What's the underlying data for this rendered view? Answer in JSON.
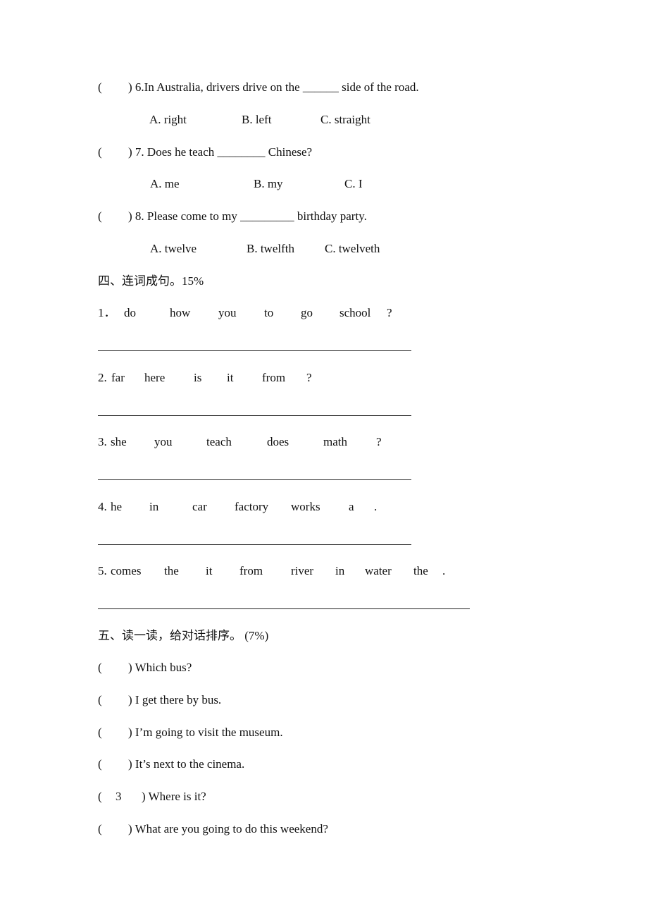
{
  "mc": [
    {
      "num": "6.",
      "stem": "In Australia, drivers drive on the ______ side of the road.",
      "answer": "",
      "options": [
        "A. right",
        "B. left",
        "C. straight"
      ]
    },
    {
      "num": "7.",
      "stem": "Does he teach ________ Chinese?",
      "answer": "",
      "options": [
        "A. me",
        "B. my",
        "C. I"
      ]
    },
    {
      "num": "8.",
      "stem": "Please come to my _________ birthday party.",
      "answer": "",
      "options": [
        "A. twelve",
        "B. twelfth",
        "C. twelveth"
      ]
    }
  ],
  "section4": {
    "title": "四、连词成句。15%",
    "items": [
      {
        "num": "1．",
        "words": [
          "do",
          "how",
          "you",
          "to",
          "go",
          "school",
          "?"
        ]
      },
      {
        "num": "2.",
        "words": [
          "far",
          "here",
          "is",
          "it",
          "from",
          "?"
        ]
      },
      {
        "num": "3.",
        "words": [
          "she",
          "you",
          "teach",
          "does",
          "math",
          "?"
        ]
      },
      {
        "num": "4.",
        "words": [
          "he",
          "in",
          "car",
          "factory",
          "works",
          "a",
          "."
        ]
      },
      {
        "num": "5.",
        "words": [
          "comes",
          "the",
          "it",
          "from",
          "river",
          "in",
          "water",
          "the",
          "."
        ]
      }
    ]
  },
  "section5": {
    "title": "五、读一读，给对话排序。 (7%)",
    "items": [
      {
        "answer": "",
        "text": ") Which bus?"
      },
      {
        "answer": "",
        "text": ") I get there by bus."
      },
      {
        "answer": "",
        "text": ") I’m going to visit the museum."
      },
      {
        "answer": "",
        "text": ") It’s next to the cinema."
      },
      {
        "answer": "3",
        "text": ") Where is it?"
      },
      {
        "answer": "",
        "text": ") What are you going to do this weekend?"
      }
    ]
  }
}
